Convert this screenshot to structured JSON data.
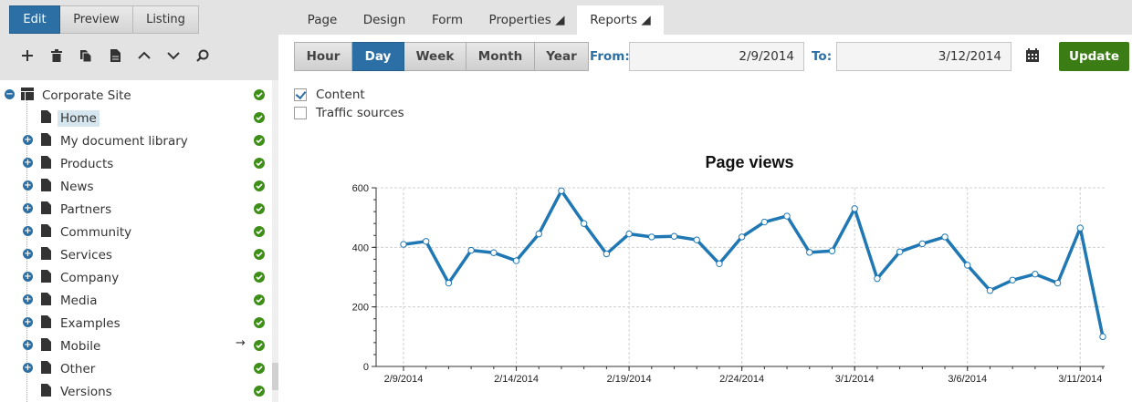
{
  "mode_tabs": [
    {
      "label": "Edit",
      "active": true
    },
    {
      "label": "Preview",
      "active": false
    },
    {
      "label": "Listing",
      "active": false
    }
  ],
  "toolbar_icons": [
    "add-icon",
    "delete-icon",
    "copy-icon",
    "document-icon",
    "chevron-up-icon",
    "chevron-down-icon",
    "search-icon"
  ],
  "tree": {
    "root": "Corporate Site",
    "items": [
      {
        "label": "Home",
        "expandable": false,
        "selected": true
      },
      {
        "label": "My document library",
        "expandable": true
      },
      {
        "label": "Products",
        "expandable": true
      },
      {
        "label": "News",
        "expandable": true
      },
      {
        "label": "Partners",
        "expandable": true
      },
      {
        "label": "Community",
        "expandable": true
      },
      {
        "label": "Services",
        "expandable": true
      },
      {
        "label": "Company",
        "expandable": true
      },
      {
        "label": "Media",
        "expandable": true
      },
      {
        "label": "Examples",
        "expandable": true
      },
      {
        "label": "Mobile",
        "expandable": true,
        "arrow": "→"
      },
      {
        "label": "Other",
        "expandable": true
      },
      {
        "label": "Versions",
        "expandable": false
      }
    ]
  },
  "nav_tabs": [
    {
      "label": "Page",
      "active": false
    },
    {
      "label": "Design",
      "active": false
    },
    {
      "label": "Form",
      "active": false
    },
    {
      "label": "Properties ◢",
      "active": false
    },
    {
      "label": "Reports ◢",
      "active": true
    }
  ],
  "periods": [
    {
      "label": "Hour",
      "active": false
    },
    {
      "label": "Day",
      "active": true
    },
    {
      "label": "Week",
      "active": false
    },
    {
      "label": "Month",
      "active": false
    },
    {
      "label": "Year",
      "active": false
    }
  ],
  "filter": {
    "from_label": "From:",
    "from_value": "2/9/2014",
    "to_label": "To:",
    "to_value": "3/12/2014",
    "update_label": "Update"
  },
  "checkboxes": [
    {
      "label": "Content",
      "checked": true
    },
    {
      "label": "Traffic sources",
      "checked": false
    }
  ],
  "colors": {
    "accent": "#2c6fa5",
    "update": "#3b7d14",
    "status_ok": "#3d8f17",
    "line": "#1f77b4"
  },
  "chart_data": {
    "type": "line",
    "title": "Page views",
    "ylim": [
      0,
      600
    ],
    "yticks": [
      0,
      200,
      400,
      600
    ],
    "xtick_labels": [
      "2/9/2014",
      "2/14/2014",
      "2/19/2014",
      "2/24/2014",
      "3/1/2014",
      "3/6/2014",
      "3/11/2014"
    ],
    "grid": true,
    "series": [
      {
        "values": [
          410,
          420,
          280,
          390,
          382,
          355,
          445,
          590,
          480,
          378,
          445,
          435,
          437,
          425,
          345,
          435,
          485,
          505,
          383,
          388,
          530,
          295,
          385,
          412,
          435,
          340,
          255,
          290,
          310,
          280,
          465,
          100
        ]
      }
    ]
  }
}
